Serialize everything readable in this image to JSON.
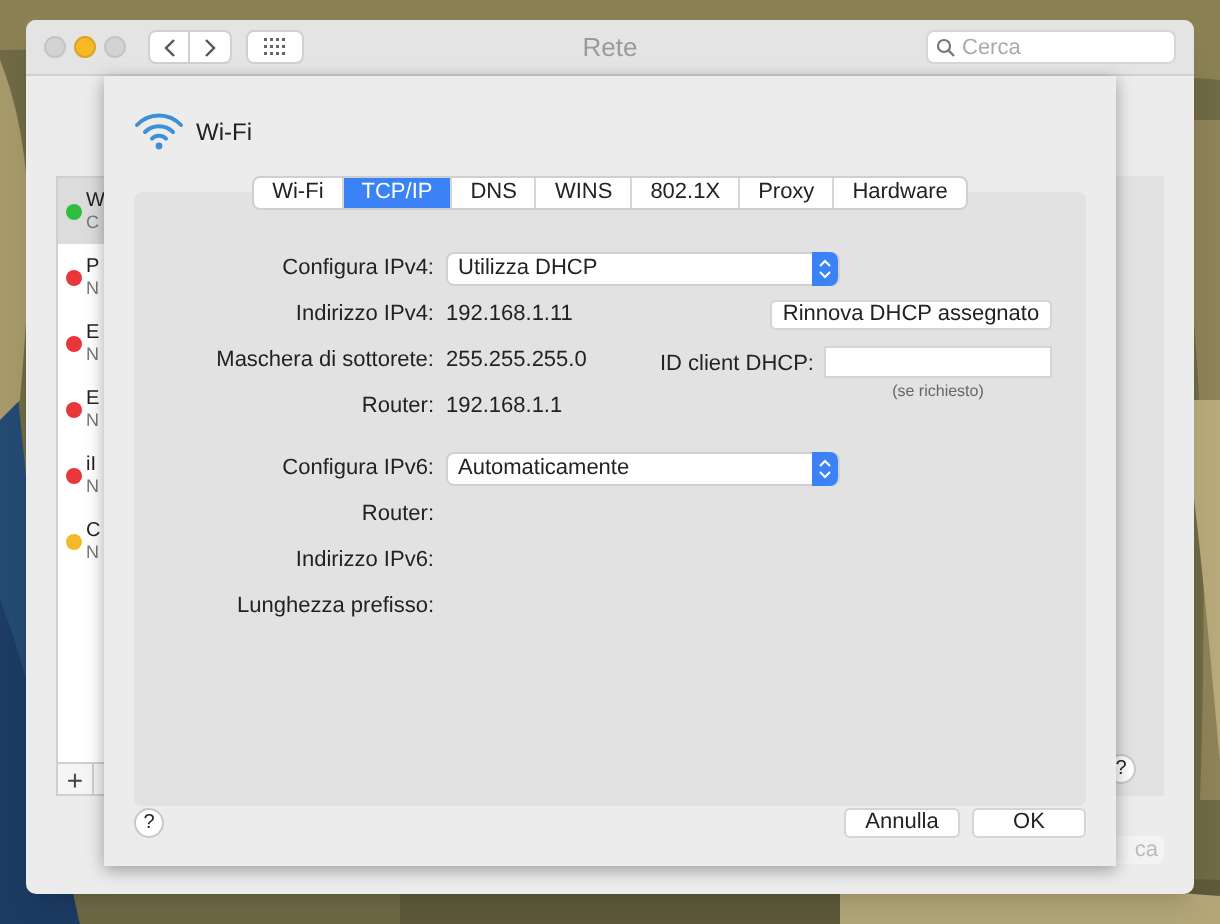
{
  "window": {
    "title": "Rete",
    "search": {
      "placeholder": "Cerca"
    }
  },
  "sidebar": {
    "items": [
      {
        "title": "W",
        "subtitle": "C",
        "color": "#2fbe3f",
        "selected": true
      },
      {
        "title": "P",
        "subtitle": "N",
        "color": "#e8363a",
        "selected": false
      },
      {
        "title": "E",
        "subtitle": "N",
        "color": "#e8363a",
        "selected": false
      },
      {
        "title": "E",
        "subtitle": "N",
        "color": "#e8363a",
        "selected": false
      },
      {
        "title": "iI",
        "subtitle": "N",
        "color": "#e8363a",
        "selected": false
      },
      {
        "title": "C",
        "subtitle": "N",
        "color": "#f5b82a",
        "selected": false
      }
    ],
    "add_button": "+"
  },
  "main": {
    "help": "?",
    "apply_button": "ca"
  },
  "sheet": {
    "service": "Wi-Fi",
    "tabs": [
      {
        "label": "Wi-Fi",
        "selected": false
      },
      {
        "label": "TCP/IP",
        "selected": true
      },
      {
        "label": "DNS",
        "selected": false
      },
      {
        "label": "WINS",
        "selected": false
      },
      {
        "label": "802.1X",
        "selected": false
      },
      {
        "label": "Proxy",
        "selected": false
      },
      {
        "label": "Hardware",
        "selected": false
      }
    ],
    "sections": [
      {
        "rows": [
          {
            "label": "Configura IPv4:",
            "kind": "popup",
            "value": "Utilizza DHCP"
          },
          {
            "label": "Indirizzo IPv4:",
            "kind": "text",
            "value": "192.168.1.11"
          },
          {
            "label": "Maschera di sottorete:",
            "kind": "text",
            "value": "255.255.255.0"
          },
          {
            "label": "Router:",
            "kind": "text",
            "value": "192.168.1.1"
          }
        ]
      },
      {
        "rows": [
          {
            "label": "Configura IPv6:",
            "kind": "popup",
            "value": "Automaticamente"
          },
          {
            "label": "Router:",
            "kind": "text"
          },
          {
            "label": "Indirizzo IPv6:",
            "kind": "text"
          },
          {
            "label": "Lunghezza prefisso:",
            "kind": "text"
          }
        ]
      }
    ],
    "renew_button": "Rinnova DHCP assegnato",
    "client_id": {
      "label": "ID client DHCP:",
      "hint": "(se richiesto)"
    },
    "help": "?",
    "buttons": [
      "Annulla",
      "OK"
    ]
  }
}
